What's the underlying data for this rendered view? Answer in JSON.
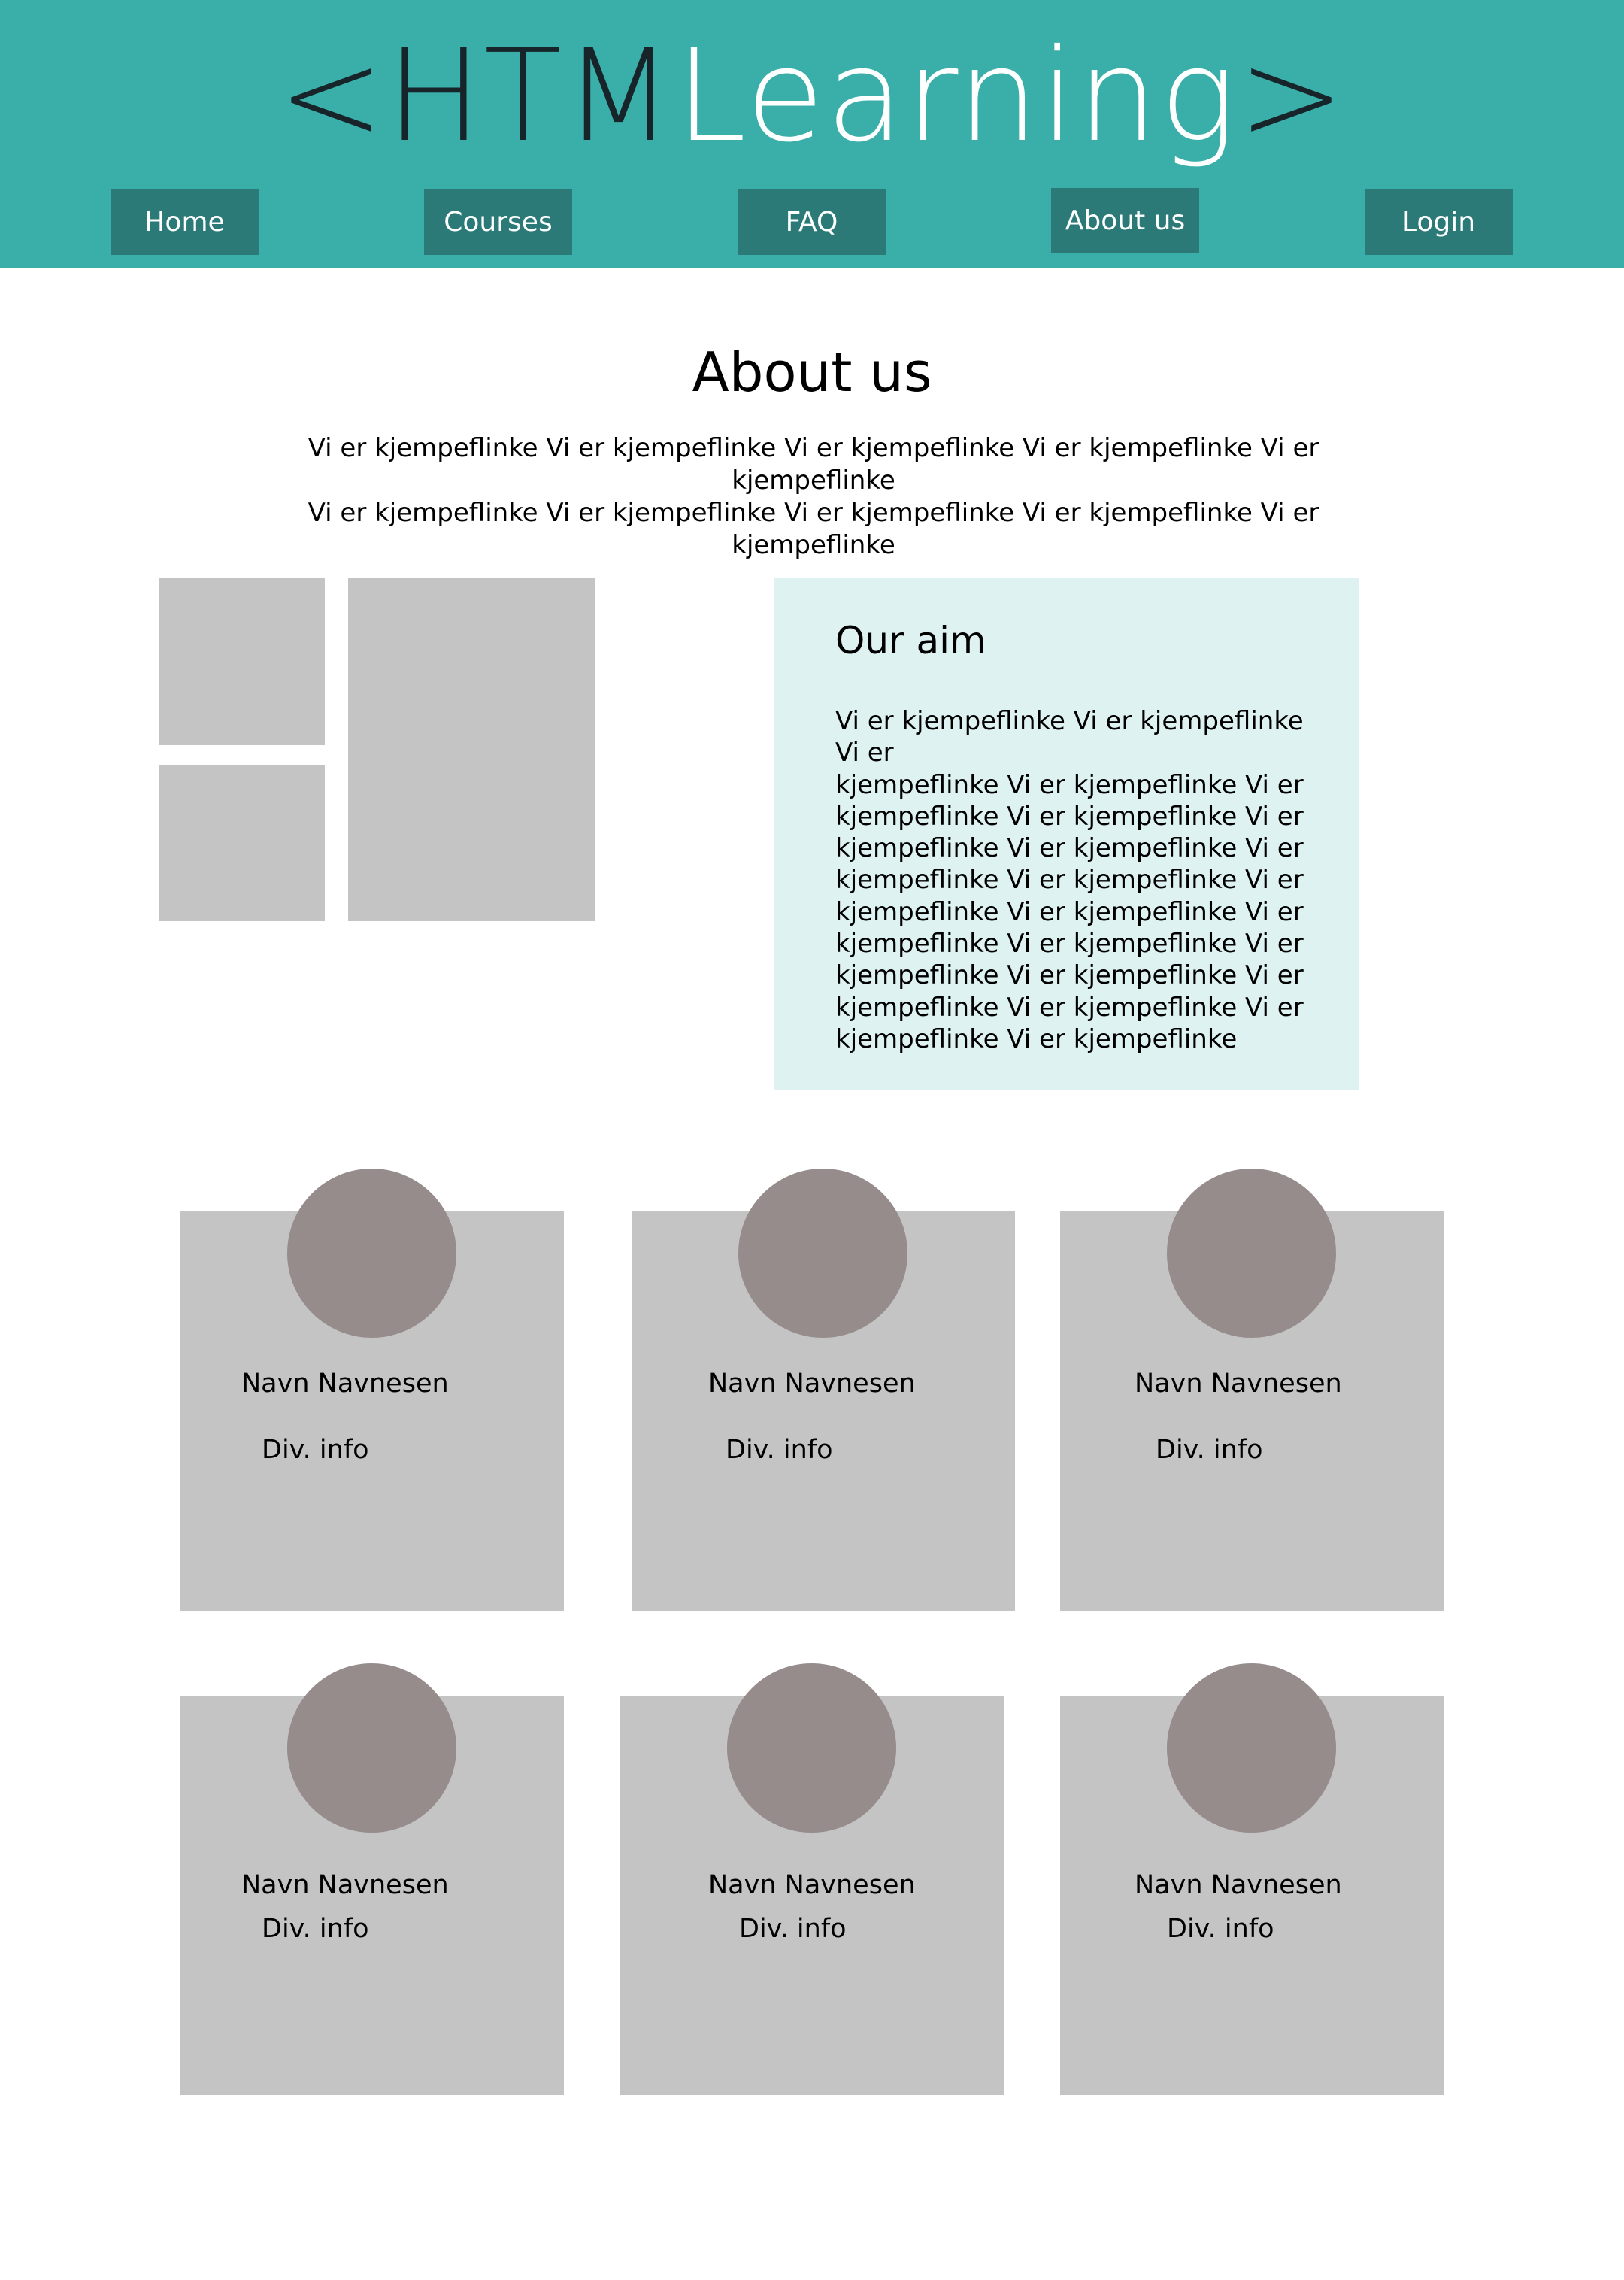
{
  "header": {
    "logo": {
      "open_bracket": "<",
      "part_dark": "HTM",
      "part_light": "Learning",
      "close_bracket": ">"
    },
    "nav": [
      {
        "label": "Home"
      },
      {
        "label": "Courses"
      },
      {
        "label": "FAQ"
      },
      {
        "label": "About us"
      },
      {
        "label": "Login"
      }
    ]
  },
  "main": {
    "title": "About us",
    "intro_lines": [
      "Vi er kjempeflinke Vi er kjempeflinke Vi er kjempeflinke Vi er kjempeflinke Vi er kjempeflinke",
      "Vi er kjempeflinke Vi er kjempeflinke Vi er kjempeflinke Vi er kjempeflinke Vi er kjempeflinke"
    ],
    "aim": {
      "title": "Our aim",
      "text_lines": [
        "Vi er kjempeflinke Vi er kjempeflinke Vi er",
        "kjempeflinke Vi er kjempeflinke Vi er",
        "kjempeflinke Vi er kjempeflinke Vi er",
        "kjempeflinke Vi er kjempeflinke Vi er",
        "kjempeflinke Vi er kjempeflinke Vi er",
        "kjempeflinke Vi er kjempeflinke Vi er",
        "kjempeflinke Vi er kjempeflinke Vi er",
        "kjempeflinke Vi er kjempeflinke Vi er",
        "kjempeflinke Vi er kjempeflinke Vi er",
        "kjempeflinke Vi er kjempeflinke"
      ]
    },
    "team": [
      {
        "name": "Navn Navnesen",
        "info": "Div. info"
      },
      {
        "name": "Navn Navnesen",
        "info": "Div. info"
      },
      {
        "name": "Navn Navnesen",
        "info": "Div. info"
      },
      {
        "name": "Navn Navnesen",
        "info": "Div. info"
      },
      {
        "name": "Navn Navnesen",
        "info": "Div. info"
      },
      {
        "name": "Navn Navnesen",
        "info": "Div. info"
      }
    ]
  },
  "colors": {
    "header_bg": "#3aafa9",
    "nav_button_bg": "#2b7a78",
    "logo_dark": "#17252a",
    "logo_light": "#feffff",
    "aim_box_bg": "#def2f1",
    "placeholder_bg": "#c4c4c4",
    "avatar_bg": "#968c8c"
  }
}
